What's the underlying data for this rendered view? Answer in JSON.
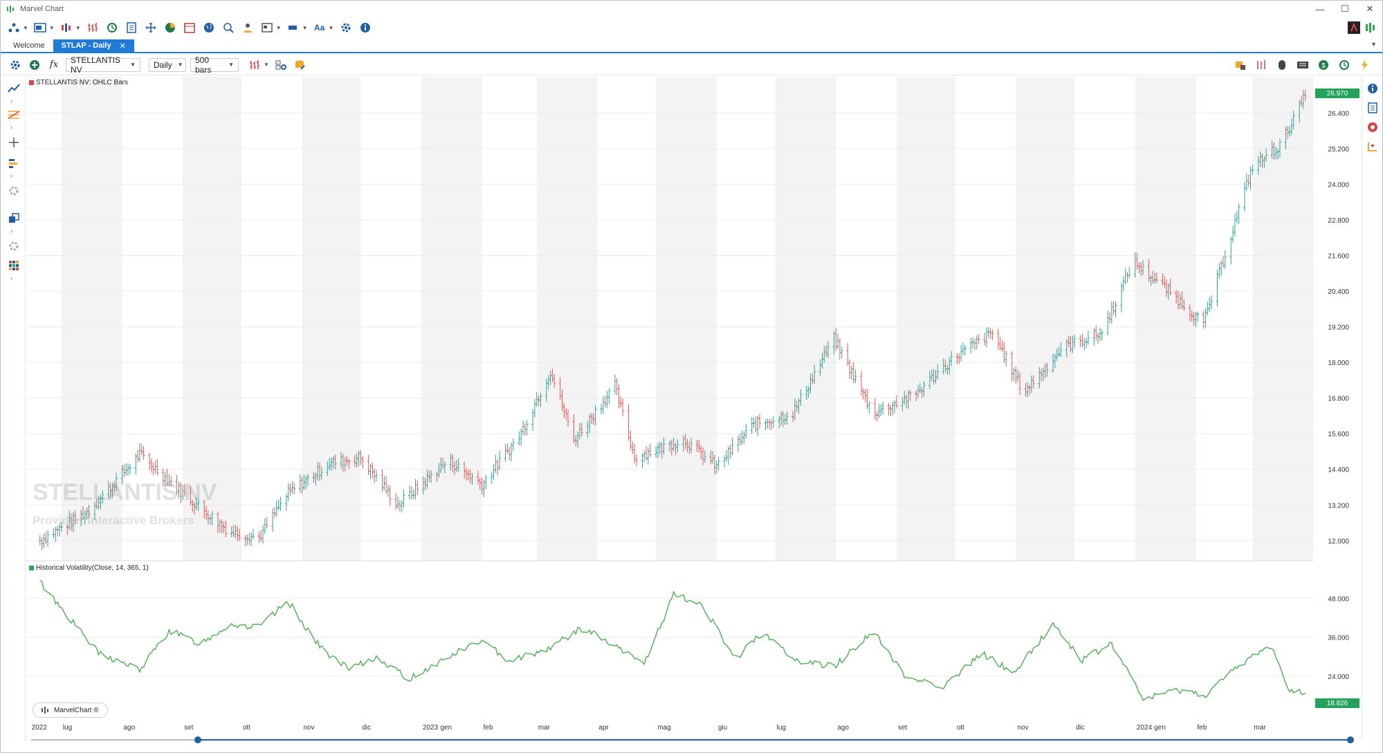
{
  "window": {
    "title": "Marvel Chart",
    "controls": {
      "minimize": "—",
      "maximize": "☐",
      "close": "✕"
    }
  },
  "toolbar1": {
    "icons": [
      "layout-icon",
      "workspace-icon",
      "chart-type-icon",
      "bar-chart-icon",
      "replay-icon",
      "report-icon",
      "crosshair-icon",
      "market-pie-icon",
      "calendar-icon",
      "globe-icon",
      "scanner-icon",
      "user-icon",
      "window-icon",
      "color-icon",
      "font-icon",
      "settings-icon",
      "info-icon"
    ],
    "font_label": "Aa"
  },
  "tabs": [
    {
      "label": "Welcome",
      "active": false
    },
    {
      "label": "STLAP - Daily",
      "active": true,
      "close": "✕"
    }
  ],
  "chart_toolbar": {
    "symbol": "STELLANTIS NV",
    "timeframe": "Daily",
    "bars": "500 bars",
    "fx_label": "fx"
  },
  "price_panel": {
    "legend": "STELLANTIS NV: OHLC Bars",
    "legend_color": "#e0443e",
    "last_price": "26.970",
    "watermark_symbol": "STELLANTIS NV",
    "watermark_provider": "Provider: Interactive Brokers",
    "y_ticks": [
      "26.400",
      "25.200",
      "24.000",
      "22.800",
      "21.600",
      "20.400",
      "19.200",
      "18.000",
      "16.800",
      "15.600",
      "14.400",
      "13.200",
      "12.000"
    ]
  },
  "volatility_panel": {
    "legend": "Historical Volatility(Close, 14, 365, 1)",
    "legend_color": "#2ea84a",
    "last_value": "18.826",
    "y_ticks": [
      "48.000",
      "36.000",
      "24.000"
    ]
  },
  "x_axis": {
    "labels": [
      "2022",
      "lug",
      "ago",
      "set",
      "ott",
      "nov",
      "dic",
      "2023",
      "gen",
      "feb",
      "mar",
      "apr",
      "mag",
      "giu",
      "lug",
      "ago",
      "set",
      "ott",
      "nov",
      "dic",
      "2024",
      "gen",
      "feb",
      "mar"
    ]
  },
  "brand_badge": "MarvelChart ®",
  "colors": {
    "accent": "#1e7bd8",
    "bull": "#26a69a",
    "bear": "#ef5350",
    "volatility": "#4caf50",
    "price_tag": "#21a35a"
  },
  "chart_data": [
    {
      "type": "ohlc",
      "title": "STELLANTIS NV: OHLC Bars",
      "x_period": [
        "2022-06",
        "2024-03"
      ],
      "ylim": [
        11.6,
        27.2
      ],
      "close_trajectory": [
        {
          "date": "2022-06-20",
          "value": 12.0
        },
        {
          "date": "2022-07-15",
          "value": 13.0
        },
        {
          "date": "2022-08-10",
          "value": 14.9
        },
        {
          "date": "2022-09-01",
          "value": 13.6
        },
        {
          "date": "2022-09-25",
          "value": 12.3
        },
        {
          "date": "2022-10-10",
          "value": 12.1
        },
        {
          "date": "2022-10-25",
          "value": 13.6
        },
        {
          "date": "2022-11-15",
          "value": 14.6
        },
        {
          "date": "2022-12-01",
          "value": 14.8
        },
        {
          "date": "2022-12-20",
          "value": 13.2
        },
        {
          "date": "2023-01-15",
          "value": 14.7
        },
        {
          "date": "2023-02-01",
          "value": 13.9
        },
        {
          "date": "2023-02-20",
          "value": 15.5
        },
        {
          "date": "2023-03-08",
          "value": 17.7
        },
        {
          "date": "2023-03-20",
          "value": 15.4
        },
        {
          "date": "2023-04-10",
          "value": 17.2
        },
        {
          "date": "2023-04-20",
          "value": 14.8
        },
        {
          "date": "2023-05-15",
          "value": 15.4
        },
        {
          "date": "2023-06-01",
          "value": 14.5
        },
        {
          "date": "2023-06-20",
          "value": 15.9
        },
        {
          "date": "2023-07-10",
          "value": 16.3
        },
        {
          "date": "2023-07-31",
          "value": 18.8
        },
        {
          "date": "2023-08-20",
          "value": 16.3
        },
        {
          "date": "2023-09-10",
          "value": 16.9
        },
        {
          "date": "2023-10-01",
          "value": 18.2
        },
        {
          "date": "2023-10-20",
          "value": 19.0
        },
        {
          "date": "2023-11-05",
          "value": 17.0
        },
        {
          "date": "2023-11-25",
          "value": 18.5
        },
        {
          "date": "2023-12-15",
          "value": 19.0
        },
        {
          "date": "2023-12-31",
          "value": 21.4
        },
        {
          "date": "2024-01-20",
          "value": 20.3
        },
        {
          "date": "2024-02-05",
          "value": 19.3
        },
        {
          "date": "2024-02-20",
          "value": 22.5
        },
        {
          "date": "2024-03-01",
          "value": 24.6
        },
        {
          "date": "2024-03-15",
          "value": 25.3
        },
        {
          "date": "2024-03-28",
          "value": 26.97
        }
      ]
    },
    {
      "type": "line",
      "title": "Historical Volatility(Close, 14, 365, 1)",
      "ylim": [
        14,
        57
      ],
      "trajectory": [
        {
          "date": "2022-06-20",
          "value": 53
        },
        {
          "date": "2022-07-05",
          "value": 42
        },
        {
          "date": "2022-07-20",
          "value": 31
        },
        {
          "date": "2022-08-10",
          "value": 26
        },
        {
          "date": "2022-08-25",
          "value": 38
        },
        {
          "date": "2022-09-10",
          "value": 34
        },
        {
          "date": "2022-09-25",
          "value": 40
        },
        {
          "date": "2022-10-10",
          "value": 39
        },
        {
          "date": "2022-10-25",
          "value": 47
        },
        {
          "date": "2022-11-10",
          "value": 33
        },
        {
          "date": "2022-11-25",
          "value": 26
        },
        {
          "date": "2022-12-10",
          "value": 30
        },
        {
          "date": "2022-12-25",
          "value": 23
        },
        {
          "date": "2023-01-15",
          "value": 30
        },
        {
          "date": "2023-01-31",
          "value": 35
        },
        {
          "date": "2023-02-15",
          "value": 29
        },
        {
          "date": "2023-03-05",
          "value": 32
        },
        {
          "date": "2023-03-25",
          "value": 39
        },
        {
          "date": "2023-04-10",
          "value": 33
        },
        {
          "date": "2023-04-25",
          "value": 28
        },
        {
          "date": "2023-05-10",
          "value": 49
        },
        {
          "date": "2023-05-25",
          "value": 46
        },
        {
          "date": "2023-06-10",
          "value": 29
        },
        {
          "date": "2023-06-25",
          "value": 38
        },
        {
          "date": "2023-07-10",
          "value": 29
        },
        {
          "date": "2023-07-31",
          "value": 27
        },
        {
          "date": "2023-08-20",
          "value": 38
        },
        {
          "date": "2023-09-05",
          "value": 24
        },
        {
          "date": "2023-09-25",
          "value": 21
        },
        {
          "date": "2023-10-15",
          "value": 31
        },
        {
          "date": "2023-10-31",
          "value": 25
        },
        {
          "date": "2023-11-20",
          "value": 40
        },
        {
          "date": "2023-12-05",
          "value": 29
        },
        {
          "date": "2023-12-20",
          "value": 34
        },
        {
          "date": "2024-01-05",
          "value": 17
        },
        {
          "date": "2024-01-25",
          "value": 20
        },
        {
          "date": "2024-02-05",
          "value": 18
        },
        {
          "date": "2024-02-25",
          "value": 28
        },
        {
          "date": "2024-03-10",
          "value": 34
        },
        {
          "date": "2024-03-20",
          "value": 20
        },
        {
          "date": "2024-03-28",
          "value": 18.826
        }
      ]
    }
  ]
}
